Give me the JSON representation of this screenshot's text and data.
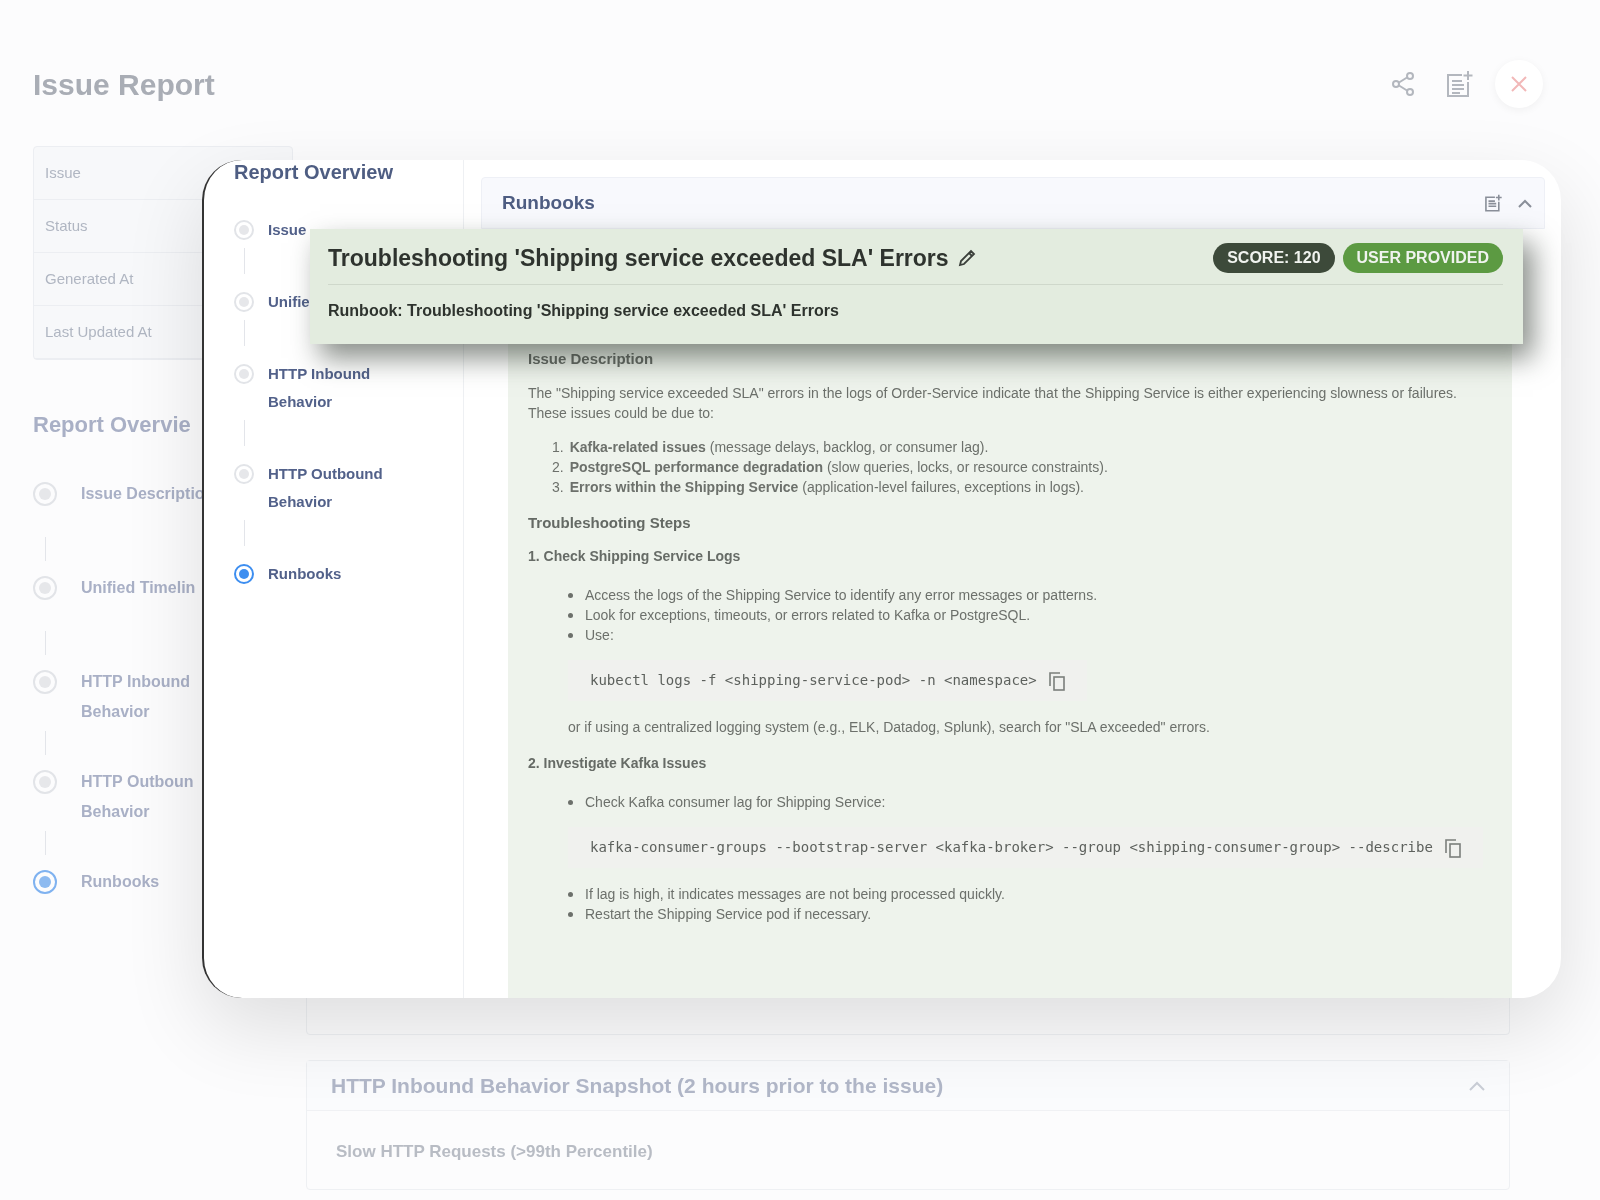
{
  "page": {
    "title": "Issue Report",
    "actions": [
      {
        "kind": "share"
      },
      {
        "kind": "note"
      },
      {
        "kind": "close"
      }
    ]
  },
  "summary_rows": [
    "Issue",
    "Status",
    "Generated At",
    "Last Updated At"
  ],
  "report_overview": {
    "title": "Report Overvie",
    "items": [
      {
        "label": "Issue Descriptio",
        "selected": false
      },
      {
        "label": "Unified Timelin",
        "selected": false
      },
      {
        "label": "HTTP Inbound Behavior",
        "selected": false
      },
      {
        "label": "HTTP Outboun Behavior",
        "selected": false
      },
      {
        "label": "Runbooks",
        "selected": true
      }
    ]
  },
  "snapshot": {
    "title": "HTTP Inbound Behavior Snapshot (2 hours prior to the issue)",
    "subtitle": "Slow HTTP Requests (>99th Percentile)"
  },
  "overlay": {
    "nav_title": "Report Overview",
    "nav_items": [
      {
        "label": "Issue",
        "selected": false
      },
      {
        "label": "Unifie",
        "selected": false
      },
      {
        "label": "HTTP Inbound Behavior",
        "selected": false
      },
      {
        "label": "HTTP Outbound Behavior",
        "selected": false
      },
      {
        "label": "Runbooks",
        "selected": true
      }
    ],
    "panel_title": "Runbooks",
    "content": [
      {
        "kind": "heading",
        "text": "Issue Description"
      },
      {
        "kind": "paragraph",
        "text": "The \"Shipping service exceeded SLA\" errors in the logs of Order-Service indicate that the Shipping Service is either experiencing slowness or failures. These issues could be due to:"
      },
      {
        "kind": "ol",
        "items": [
          {
            "number": "1.",
            "text": "**Kafka-related issues** (message delays, backlog, or consumer lag)."
          },
          {
            "number": "2.",
            "text": "**PostgreSQL performance degradation** (slow queries, locks, or resource constraints)."
          },
          {
            "number": "3.",
            "text": "**Errors within the Shipping Service** (application-level failures, exceptions in logs)."
          }
        ]
      },
      {
        "kind": "heading",
        "text": "Troubleshooting Steps"
      },
      {
        "kind": "step",
        "text": "1. Check Shipping Service Logs"
      },
      {
        "kind": "ul",
        "items": [
          "Access the logs of the Shipping Service to identify any error messages or patterns.",
          "Look for exceptions, timeouts, or errors related to Kafka or PostgreSQL.",
          "Use:"
        ]
      },
      {
        "kind": "code",
        "text": "kubectl logs -f <shipping-service-pod> -n <namespace>"
      },
      {
        "kind": "note",
        "text": "or if using a centralized logging system (e.g., ELK, Datadog, Splunk), search for \"SLA exceeded\" errors."
      },
      {
        "kind": "step",
        "text": "2. Investigate Kafka Issues"
      },
      {
        "kind": "ul",
        "items": [
          "Check Kafka consumer lag for Shipping Service:"
        ]
      },
      {
        "kind": "code",
        "text": "kafka-consumer-groups --bootstrap-server <kafka-broker> --group <shipping-consumer-group> --describe"
      },
      {
        "kind": "ul",
        "items": [
          "If lag is high, it indicates messages are not being processed quickly.",
          "Restart the Shipping Service pod if necessary."
        ]
      }
    ]
  },
  "popup": {
    "title": "Troubleshooting 'Shipping service exceeded SLA' Errors",
    "badges": [
      {
        "text": "SCORE: 120",
        "kind": "score"
      },
      {
        "text": "USER PROVIDED",
        "kind": "source"
      }
    ],
    "subtitle": "Runbook: Troubleshooting 'Shipping service exceeded SLA' Errors"
  }
}
